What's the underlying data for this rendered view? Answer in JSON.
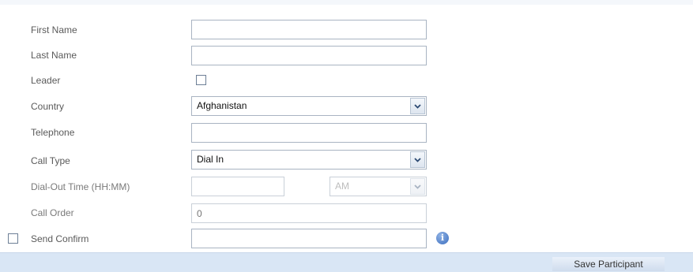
{
  "form": {
    "first_name": {
      "label": "First Name",
      "value": ""
    },
    "last_name": {
      "label": "Last Name",
      "value": ""
    },
    "leader": {
      "label": "Leader",
      "checked": false
    },
    "country": {
      "label": "Country",
      "selected": "Afghanistan"
    },
    "telephone": {
      "label": "Telephone",
      "value": ""
    },
    "call_type": {
      "label": "Call Type",
      "selected": "Dial In"
    },
    "dial_out_time": {
      "label": "Dial-Out Time  (HH:MM)",
      "value": "",
      "ampm": "AM",
      "disabled": true
    },
    "call_order": {
      "label": "Call Order",
      "placeholder": "0",
      "disabled": true
    },
    "send_confirm": {
      "label": "Send Confirm",
      "checked": false,
      "value": ""
    }
  },
  "icons": {
    "dropdown": "chevron-down-icon",
    "info": "info-icon",
    "info_glyph": "i"
  },
  "footer": {
    "save_label": "Save Participant"
  },
  "colors": {
    "footer_bg": "#d9e6f5",
    "info_blue": "#3d6fc0",
    "field_border": "#a9b4c2"
  }
}
